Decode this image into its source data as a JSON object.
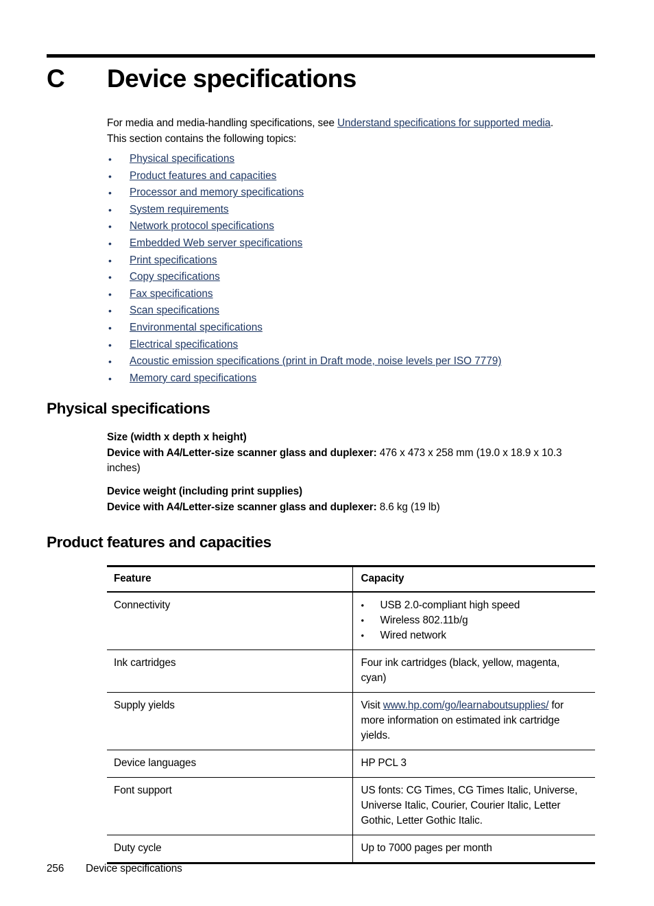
{
  "chapter": {
    "letter": "C",
    "title": "Device specifications"
  },
  "intro": {
    "line1_before": "For media and media-handling specifications, see ",
    "line1_link": "Understand specifications for supported media",
    "line1_after": ".",
    "line2": "This section contains the following topics:"
  },
  "topics": {
    "bullet": "•",
    "items": [
      "Physical specifications",
      "Product features and capacities",
      "Processor and memory specifications",
      "System requirements",
      "Network protocol specifications",
      "Embedded Web server specifications",
      "Print specifications",
      "Copy specifications",
      "Fax specifications",
      "Scan specifications",
      "Environmental specifications",
      "Electrical specifications",
      "Acoustic emission specifications (print in Draft mode, noise levels per ISO 7779)",
      "Memory card specifications"
    ]
  },
  "physical": {
    "heading": "Physical specifications",
    "size_title": "Size (width x depth x height)",
    "size_label": "Device with A4/Letter-size scanner glass and duplexer:",
    "size_value": " 476 x 473 x 258 mm (19.0 x 18.9 x 10.3 inches)",
    "weight_title": "Device weight (including print supplies)",
    "weight_label": "Device with A4/Letter-size scanner glass and duplexer:",
    "weight_value": " 8.6 kg (19 lb)"
  },
  "product": {
    "heading": "Product features and capacities",
    "table": {
      "headers": [
        "Feature",
        "Capacity"
      ],
      "bullet": "•",
      "rows": [
        {
          "feature": "Connectivity",
          "type": "list",
          "capacity_items": [
            "USB 2.0-compliant high speed",
            "Wireless 802.11b/g",
            "Wired network"
          ]
        },
        {
          "feature": "Ink cartridges",
          "type": "text",
          "capacity": "Four ink cartridges (black, yellow, magenta, cyan)"
        },
        {
          "feature": "Supply yields",
          "type": "link",
          "capacity_before": "Visit ",
          "capacity_link": "www.hp.com/go/learnaboutsupplies/",
          "capacity_after": " for more information on estimated ink cartridge yields."
        },
        {
          "feature": "Device languages",
          "type": "text",
          "capacity": "HP PCL 3"
        },
        {
          "feature": "Font support",
          "type": "text",
          "capacity": "US fonts: CG Times, CG Times Italic, Universe, Universe Italic, Courier, Courier Italic, Letter Gothic, Letter Gothic Italic."
        },
        {
          "feature": "Duty cycle",
          "type": "text",
          "capacity": "Up to 7000 pages per month"
        }
      ]
    }
  },
  "footer": {
    "page_number": "256",
    "chapter_name": "Device specifications"
  },
  "colors": {
    "link": "#1F3864",
    "text": "#000000",
    "rule": "#000000"
  }
}
